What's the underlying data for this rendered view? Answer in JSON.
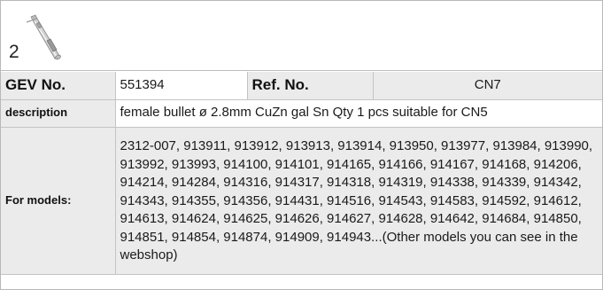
{
  "product": {
    "item_number": "2",
    "icon": "bullet-connector-icon"
  },
  "spec": {
    "gev_label": "GEV No.",
    "gev_value": "551394",
    "ref_label": "Ref. No.",
    "ref_value": "CN7",
    "description_label": "description",
    "description_value": "female bullet  ø 2.8mm CuZn gal Sn Qty 1 pcs suitable for CN5",
    "models_label": "For models:",
    "models_value": "2312-007, 913911, 913912, 913913, 913914, 913950, 913977, 913984, 913990, 913992, 913993, 914100, 914101, 914165, 914166, 914167, 914168, 914206, 914214, 914284, 914316, 914317, 914318, 914319, 914338, 914339, 914342, 914343, 914355, 914356, 914431, 914516, 914543, 914583, 914592, 914612, 914613, 914624, 914625, 914626, 914627, 914628, 914642, 914684, 914850, 914851, 914854, 914874, 914909, 914943...(Other models you can see in the webshop)"
  },
  "colors": {
    "label_background": "#ebebeb",
    "border": "#c4c4c4"
  }
}
